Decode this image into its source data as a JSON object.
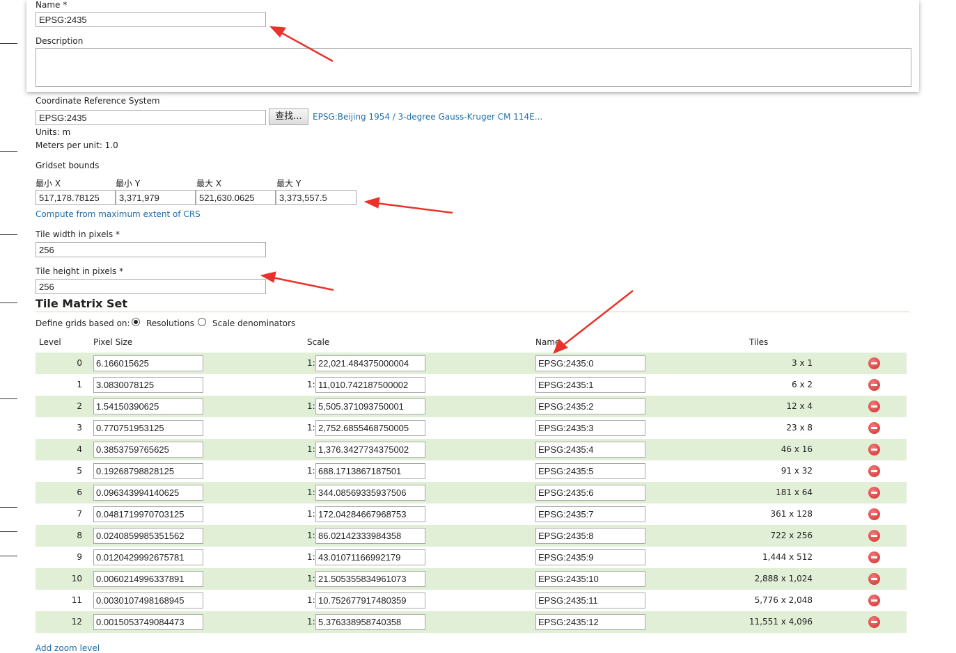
{
  "form": {
    "name_label": "Name *",
    "name_value": "EPSG:2435",
    "description_label": "Description",
    "description_value": "",
    "crs_label": "Coordinate Reference System",
    "crs_value": "EPSG:2435",
    "find_button": "查找...",
    "crs_link": "EPSG:Beijing 1954 / 3-degree Gauss-Kruger CM 114E...",
    "units": "Units: m",
    "meters_per_unit": "Meters per unit: 1.0",
    "gridset_bounds_label": "Gridset bounds",
    "bounds": {
      "min_x_label": "最小 X",
      "min_x": "517,178.78125",
      "min_y_label": "最小 Y",
      "min_y": "3,371,979",
      "max_x_label": "最大 X",
      "max_x": "521,630.0625",
      "max_y_label": "最大 Y",
      "max_y": "3,373,557.5"
    },
    "compute_link": "Compute from maximum extent of CRS",
    "tile_width_label": "Tile width in pixels *",
    "tile_width": "256",
    "tile_height_label": "Tile height in pixels *",
    "tile_height": "256"
  },
  "matrix": {
    "title": "Tile Matrix Set",
    "define_label": "Define grids based on:",
    "option_resolutions": "Resolutions",
    "option_scale": "Scale denominators",
    "selected_option": "Resolutions",
    "headers": {
      "level": "Level",
      "pixel_size": "Pixel Size",
      "scale": "Scale",
      "name": "Name",
      "tiles": "Tiles"
    },
    "scale_prefix": "1:",
    "rows": [
      {
        "level": "0",
        "pixel": "6.166015625",
        "scale": "22,021.484375000004",
        "name": "EPSG:2435:0",
        "tiles": "3 x 1"
      },
      {
        "level": "1",
        "pixel": "3.0830078125",
        "scale": "11,010.742187500002",
        "name": "EPSG:2435:1",
        "tiles": "6 x 2"
      },
      {
        "level": "2",
        "pixel": "1.54150390625",
        "scale": "5,505.371093750001",
        "name": "EPSG:2435:2",
        "tiles": "12 x 4"
      },
      {
        "level": "3",
        "pixel": "0.770751953125",
        "scale": "2,752.6855468750005",
        "name": "EPSG:2435:3",
        "tiles": "23 x 8"
      },
      {
        "level": "4",
        "pixel": "0.3853759765625",
        "scale": "1,376.3427734375002",
        "name": "EPSG:2435:4",
        "tiles": "46 x 16"
      },
      {
        "level": "5",
        "pixel": "0.19268798828125",
        "scale": "688.1713867187501",
        "name": "EPSG:2435:5",
        "tiles": "91 x 32"
      },
      {
        "level": "6",
        "pixel": "0.096343994140625",
        "scale": "344.08569335937506",
        "name": "EPSG:2435:6",
        "tiles": "181 x 64"
      },
      {
        "level": "7",
        "pixel": "0.0481719970703125",
        "scale": "172.04284667968753",
        "name": "EPSG:2435:7",
        "tiles": "361 x 128"
      },
      {
        "level": "8",
        "pixel": "0.0240859985351562",
        "scale": "86.02142333984358",
        "name": "EPSG:2435:8",
        "tiles": "722 x 256"
      },
      {
        "level": "9",
        "pixel": "0.0120429992675781",
        "scale": "43.01071166992179",
        "name": "EPSG:2435:9",
        "tiles": "1,444 x 512"
      },
      {
        "level": "10",
        "pixel": "0.0060214996337891",
        "scale": "21.505355834961073",
        "name": "EPSG:2435:10",
        "tiles": "2,888 x 1,024"
      },
      {
        "level": "11",
        "pixel": "0.0030107498168945",
        "scale": "10.752677917480359",
        "name": "EPSG:2435:11",
        "tiles": "5,776 x 2,048"
      },
      {
        "level": "12",
        "pixel": "0.0015053749084473",
        "scale": "5.376338958740358",
        "name": "EPSG:2435:12",
        "tiles": "11,551 x 4,096"
      }
    ],
    "add_zoom_link": "Add zoom level"
  },
  "colors": {
    "row_shade": "#e1efd7",
    "link": "#1f6fa8",
    "annotation_arrow": "#e8322b",
    "remove_icon": "#d12b2b"
  }
}
